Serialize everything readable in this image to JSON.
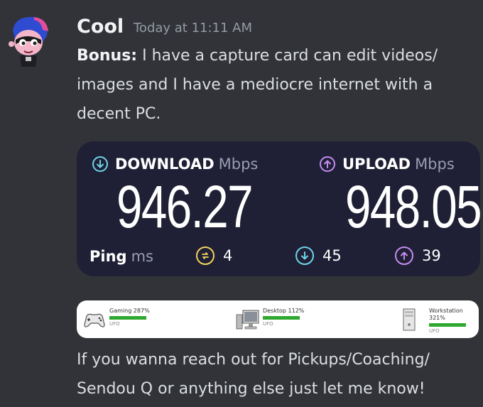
{
  "message": {
    "author": "Cool",
    "timestamp": "Today at 11:11 AM",
    "bonus_label": "Bonus:",
    "bonus_text": " I have a capture card can edit videos/ images and I have a mediocre internet with a decent PC.",
    "followup_text": "If you wanna reach out for Pickups/Coaching/ Sendou Q or anything else just let me know!"
  },
  "speedtest": {
    "download_label": "DOWNLOAD",
    "upload_label": "UPLOAD",
    "unit": "Mbps",
    "download_value": "946.27",
    "upload_value": "948.05",
    "ping_label": "Ping",
    "ping_unit": "ms",
    "ping_idle": "4",
    "ping_download": "45",
    "ping_upload": "39",
    "colors": {
      "download": "#6fd4e8",
      "upload": "#c58cf2",
      "idle": "#f4d35e"
    }
  },
  "benchmark": {
    "items": [
      {
        "label": "Gaming 287%",
        "sub": "UFO",
        "icon": "gamepad-icon"
      },
      {
        "label": "Desktop 112%",
        "sub": "UFO",
        "icon": "desktop-computer-icon"
      },
      {
        "label": "Workstation 321%",
        "sub": "UFO",
        "icon": "workstation-tower-icon"
      }
    ]
  }
}
